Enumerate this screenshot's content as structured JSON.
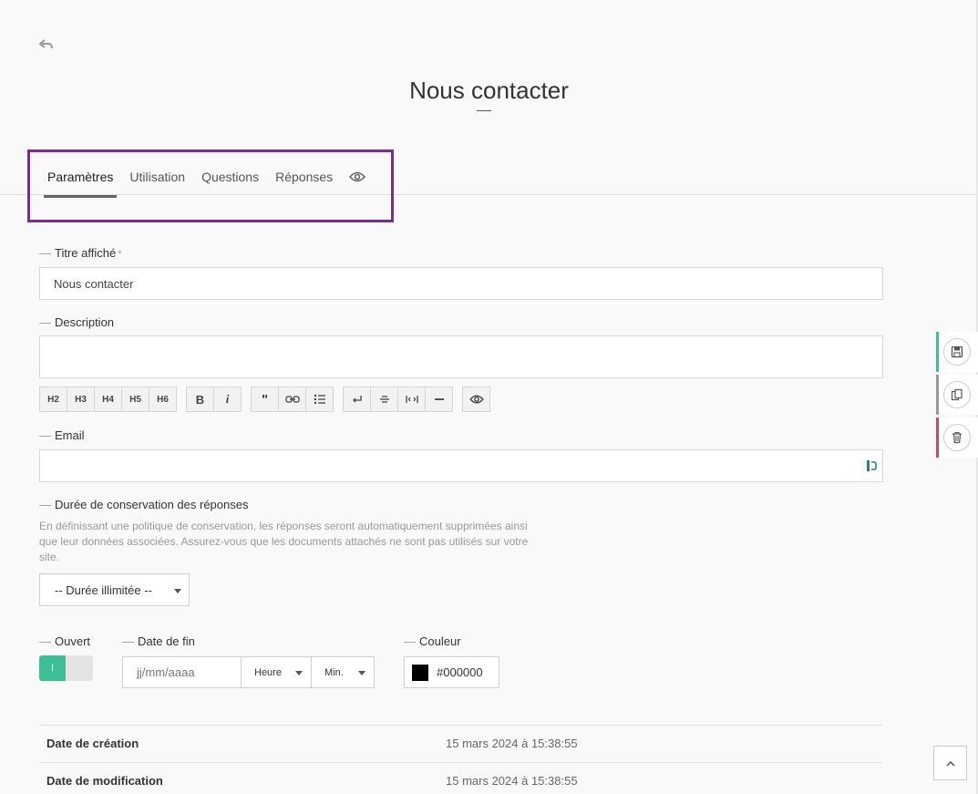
{
  "header": {
    "title": "Nous contacter"
  },
  "tabs": [
    {
      "label": "Paramètres"
    },
    {
      "label": "Utilisation"
    },
    {
      "label": "Questions"
    },
    {
      "label": "Réponses"
    }
  ],
  "form": {
    "title_label": "Titre affiché",
    "title_required": "*",
    "title_value": "Nous contacter",
    "description_label": "Description",
    "editor_headings": [
      "H2",
      "H3",
      "H4",
      "H5",
      "H6"
    ],
    "email_label": "Email",
    "retention_label": "Durée de conservation des réponses",
    "retention_hint": "En définissant une politique de conservation, les réponses seront automatiquement supprimées ainsi que leur données associées. Assurez-vous que les documents attachés ne sont pas utilisés sur votre site.",
    "retention_value": "-- Durée illimitée --",
    "open_label": "Ouvert",
    "toggle_on": "I",
    "end_date_label": "Date de fin",
    "date_placeholder": "jj/mm/aaaa",
    "hour_value": "Heure",
    "minute_value": "Min.",
    "color_label": "Couleur",
    "color_value": "#000000"
  },
  "meta": {
    "created_label": "Date de création",
    "created_value": "15 mars 2024 à 15:38:55",
    "modified_label": "Date de modification",
    "modified_value": "15 mars 2024 à 15:38:55"
  },
  "colors": {
    "accent": "#3cbf96",
    "highlight": "#7b2d8e",
    "delete": "#d0455f",
    "neutral": "#999999"
  }
}
